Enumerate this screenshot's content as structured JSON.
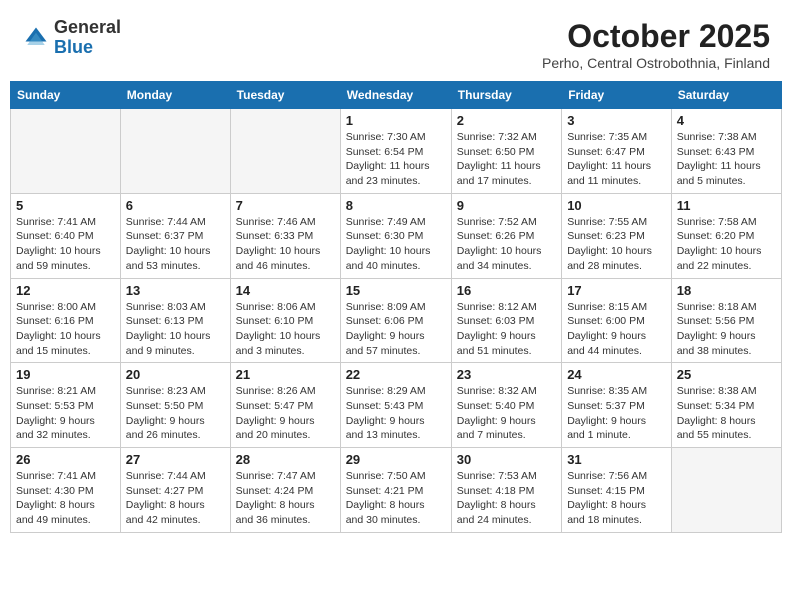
{
  "header": {
    "logo_general": "General",
    "logo_blue": "Blue",
    "month_title": "October 2025",
    "location": "Perho, Central Ostrobothnia, Finland"
  },
  "days_of_week": [
    "Sunday",
    "Monday",
    "Tuesday",
    "Wednesday",
    "Thursday",
    "Friday",
    "Saturday"
  ],
  "weeks": [
    [
      {
        "day": "",
        "info": ""
      },
      {
        "day": "",
        "info": ""
      },
      {
        "day": "",
        "info": ""
      },
      {
        "day": "1",
        "info": "Sunrise: 7:30 AM\nSunset: 6:54 PM\nDaylight: 11 hours\nand 23 minutes."
      },
      {
        "day": "2",
        "info": "Sunrise: 7:32 AM\nSunset: 6:50 PM\nDaylight: 11 hours\nand 17 minutes."
      },
      {
        "day": "3",
        "info": "Sunrise: 7:35 AM\nSunset: 6:47 PM\nDaylight: 11 hours\nand 11 minutes."
      },
      {
        "day": "4",
        "info": "Sunrise: 7:38 AM\nSunset: 6:43 PM\nDaylight: 11 hours\nand 5 minutes."
      }
    ],
    [
      {
        "day": "5",
        "info": "Sunrise: 7:41 AM\nSunset: 6:40 PM\nDaylight: 10 hours\nand 59 minutes."
      },
      {
        "day": "6",
        "info": "Sunrise: 7:44 AM\nSunset: 6:37 PM\nDaylight: 10 hours\nand 53 minutes."
      },
      {
        "day": "7",
        "info": "Sunrise: 7:46 AM\nSunset: 6:33 PM\nDaylight: 10 hours\nand 46 minutes."
      },
      {
        "day": "8",
        "info": "Sunrise: 7:49 AM\nSunset: 6:30 PM\nDaylight: 10 hours\nand 40 minutes."
      },
      {
        "day": "9",
        "info": "Sunrise: 7:52 AM\nSunset: 6:26 PM\nDaylight: 10 hours\nand 34 minutes."
      },
      {
        "day": "10",
        "info": "Sunrise: 7:55 AM\nSunset: 6:23 PM\nDaylight: 10 hours\nand 28 minutes."
      },
      {
        "day": "11",
        "info": "Sunrise: 7:58 AM\nSunset: 6:20 PM\nDaylight: 10 hours\nand 22 minutes."
      }
    ],
    [
      {
        "day": "12",
        "info": "Sunrise: 8:00 AM\nSunset: 6:16 PM\nDaylight: 10 hours\nand 15 minutes."
      },
      {
        "day": "13",
        "info": "Sunrise: 8:03 AM\nSunset: 6:13 PM\nDaylight: 10 hours\nand 9 minutes."
      },
      {
        "day": "14",
        "info": "Sunrise: 8:06 AM\nSunset: 6:10 PM\nDaylight: 10 hours\nand 3 minutes."
      },
      {
        "day": "15",
        "info": "Sunrise: 8:09 AM\nSunset: 6:06 PM\nDaylight: 9 hours\nand 57 minutes."
      },
      {
        "day": "16",
        "info": "Sunrise: 8:12 AM\nSunset: 6:03 PM\nDaylight: 9 hours\nand 51 minutes."
      },
      {
        "day": "17",
        "info": "Sunrise: 8:15 AM\nSunset: 6:00 PM\nDaylight: 9 hours\nand 44 minutes."
      },
      {
        "day": "18",
        "info": "Sunrise: 8:18 AM\nSunset: 5:56 PM\nDaylight: 9 hours\nand 38 minutes."
      }
    ],
    [
      {
        "day": "19",
        "info": "Sunrise: 8:21 AM\nSunset: 5:53 PM\nDaylight: 9 hours\nand 32 minutes."
      },
      {
        "day": "20",
        "info": "Sunrise: 8:23 AM\nSunset: 5:50 PM\nDaylight: 9 hours\nand 26 minutes."
      },
      {
        "day": "21",
        "info": "Sunrise: 8:26 AM\nSunset: 5:47 PM\nDaylight: 9 hours\nand 20 minutes."
      },
      {
        "day": "22",
        "info": "Sunrise: 8:29 AM\nSunset: 5:43 PM\nDaylight: 9 hours\nand 13 minutes."
      },
      {
        "day": "23",
        "info": "Sunrise: 8:32 AM\nSunset: 5:40 PM\nDaylight: 9 hours\nand 7 minutes."
      },
      {
        "day": "24",
        "info": "Sunrise: 8:35 AM\nSunset: 5:37 PM\nDaylight: 9 hours\nand 1 minute."
      },
      {
        "day": "25",
        "info": "Sunrise: 8:38 AM\nSunset: 5:34 PM\nDaylight: 8 hours\nand 55 minutes."
      }
    ],
    [
      {
        "day": "26",
        "info": "Sunrise: 7:41 AM\nSunset: 4:30 PM\nDaylight: 8 hours\nand 49 minutes."
      },
      {
        "day": "27",
        "info": "Sunrise: 7:44 AM\nSunset: 4:27 PM\nDaylight: 8 hours\nand 42 minutes."
      },
      {
        "day": "28",
        "info": "Sunrise: 7:47 AM\nSunset: 4:24 PM\nDaylight: 8 hours\nand 36 minutes."
      },
      {
        "day": "29",
        "info": "Sunrise: 7:50 AM\nSunset: 4:21 PM\nDaylight: 8 hours\nand 30 minutes."
      },
      {
        "day": "30",
        "info": "Sunrise: 7:53 AM\nSunset: 4:18 PM\nDaylight: 8 hours\nand 24 minutes."
      },
      {
        "day": "31",
        "info": "Sunrise: 7:56 AM\nSunset: 4:15 PM\nDaylight: 8 hours\nand 18 minutes."
      },
      {
        "day": "",
        "info": ""
      }
    ]
  ]
}
